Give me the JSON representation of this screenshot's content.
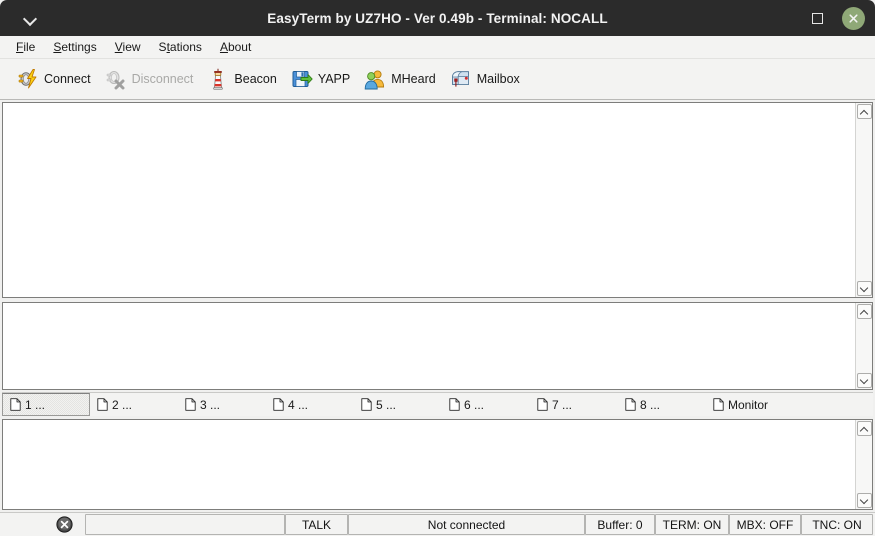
{
  "window": {
    "title": "EasyTerm by UZ7HO - Ver 0.49b - Terminal: NOCALL",
    "collapse_icon": "chevron-down-icon",
    "maximize_icon": "maximize-icon",
    "close_icon": "close-icon",
    "titlebar_color": "#2b2b2b",
    "close_button_color": "#8fa877"
  },
  "menubar": {
    "items": [
      {
        "label": "File",
        "accel": "F"
      },
      {
        "label": "Settings",
        "accel": "S"
      },
      {
        "label": "View",
        "accel": "V"
      },
      {
        "label": "Stations",
        "accel": "t"
      },
      {
        "label": "About",
        "accel": "A"
      }
    ]
  },
  "toolbar": {
    "buttons": [
      {
        "label": "Connect",
        "icon": "plug-lightning-icon",
        "enabled": true
      },
      {
        "label": "Disconnect",
        "icon": "plug-disconnect-icon",
        "enabled": false
      },
      {
        "label": "Beacon",
        "icon": "lighthouse-icon",
        "enabled": true
      },
      {
        "label": "YAPP",
        "icon": "floppy-arrow-icon",
        "enabled": true
      },
      {
        "label": "MHeard",
        "icon": "two-people-icon",
        "enabled": true
      },
      {
        "label": "Mailbox",
        "icon": "mailbox-icon",
        "enabled": true
      }
    ]
  },
  "panels": {
    "receive": {
      "text": ""
    },
    "middle": {
      "text": ""
    },
    "send": {
      "text": ""
    }
  },
  "tabs": {
    "items": [
      {
        "label": "1 ...",
        "selected": true
      },
      {
        "label": "2 ...",
        "selected": false
      },
      {
        "label": "3 ...",
        "selected": false
      },
      {
        "label": "4 ...",
        "selected": false
      },
      {
        "label": "5 ...",
        "selected": false
      },
      {
        "label": "6 ...",
        "selected": false
      },
      {
        "label": "7 ...",
        "selected": false
      },
      {
        "label": "8 ...",
        "selected": false
      },
      {
        "label": "Monitor",
        "selected": false
      }
    ]
  },
  "statusbar": {
    "status_icon": "cancel-circle-icon",
    "input_value": "",
    "talk": "TALK",
    "connection": "Not connected",
    "buffer": "Buffer: 0",
    "term": "TERM: ON",
    "mbx": "MBX: OFF",
    "tnc": "TNC: ON"
  }
}
